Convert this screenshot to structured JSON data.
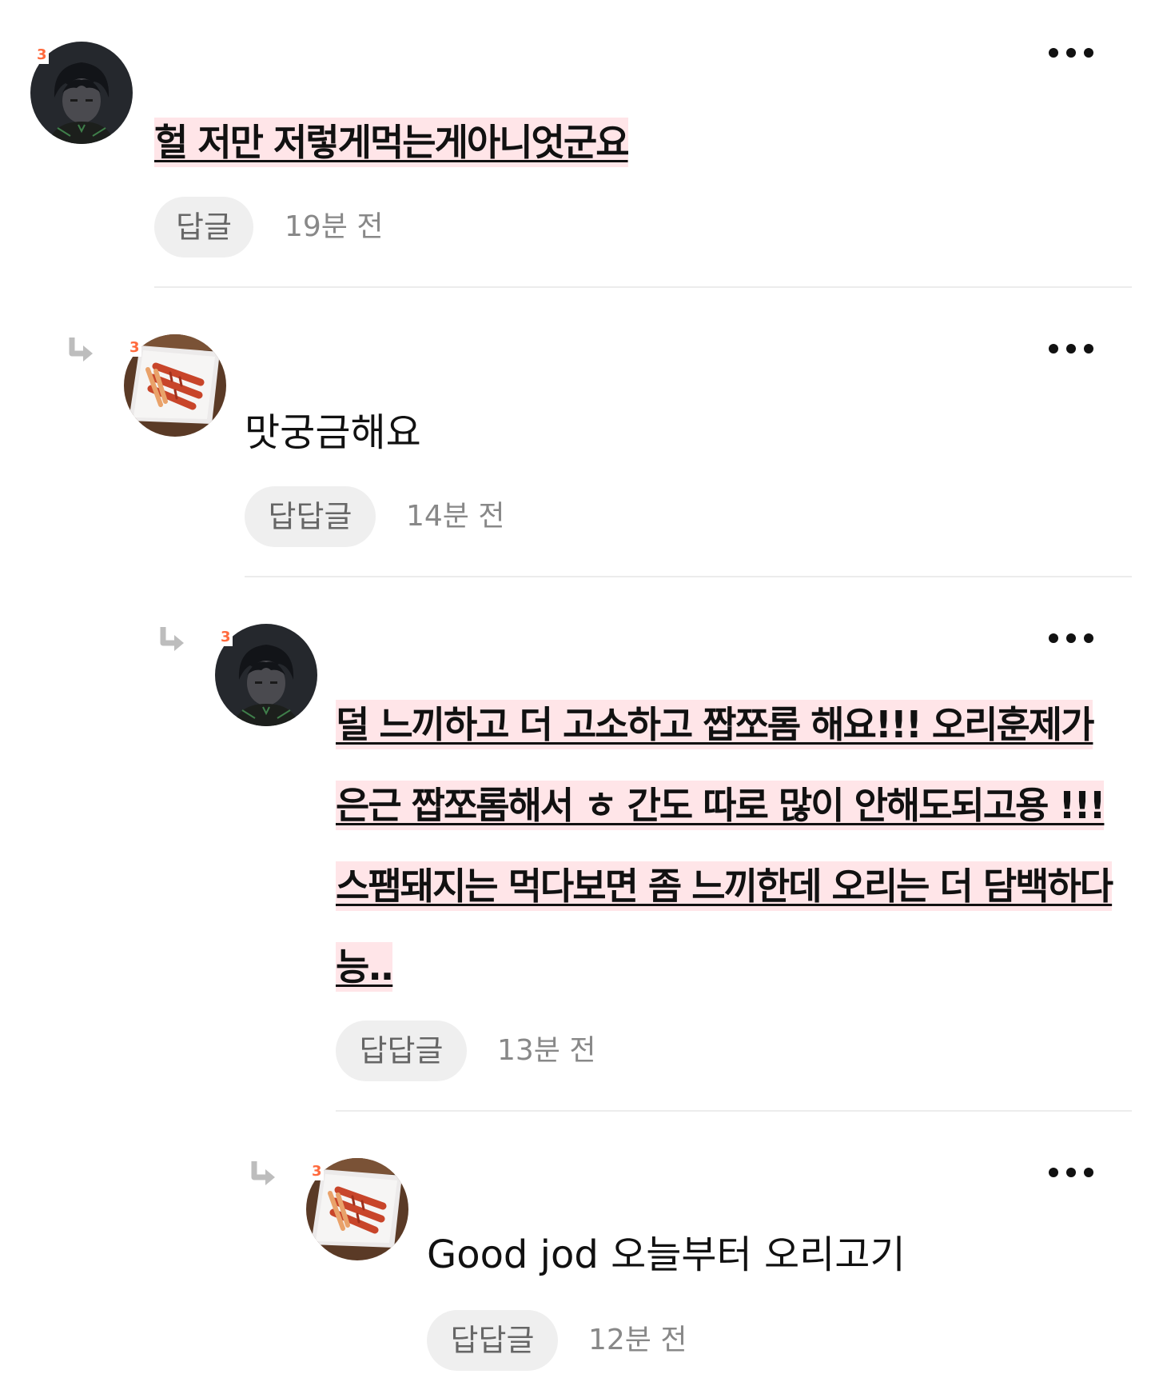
{
  "comments": [
    {
      "level_badge": "3",
      "avatar": "anime-boy-avatar",
      "text": "헐 저만 저렇게먹는게아니엇군요",
      "highlighted": true,
      "reply_label": "답글",
      "time": "19분 전"
    },
    {
      "level_badge": "3",
      "avatar": "food-plate-avatar",
      "text": "맛궁금해요",
      "highlighted": false,
      "reply_label": "답답글",
      "time": "14분 전"
    },
    {
      "level_badge": "3",
      "avatar": "anime-boy-avatar",
      "text": "덜 느끼하고 더 고소하고 짭쪼롬 해요!!! 오리훈제가 은근 짭쪼롬해서 ㅎ 간도 따로 많이 안해도되고용 !!! 스팸돼지는 먹다보면 좀 느끼한데 오리는 더 담백하다능..",
      "highlighted": true,
      "reply_label": "답답글",
      "time": "13분 전"
    },
    {
      "level_badge": "3",
      "avatar": "food-plate-avatar",
      "text": "Good jod 오늘부터 오리고기",
      "highlighted": false,
      "reply_label": "답답글",
      "time": "12분 전"
    }
  ],
  "colors": {
    "highlight": "#ffe5e8",
    "badge": "#ff6a3d",
    "reply_button_bg": "#efefef",
    "time_text": "#888888"
  },
  "icons": {
    "more": "more-dots-icon",
    "reply_arrow": "reply-arrow-icon"
  }
}
